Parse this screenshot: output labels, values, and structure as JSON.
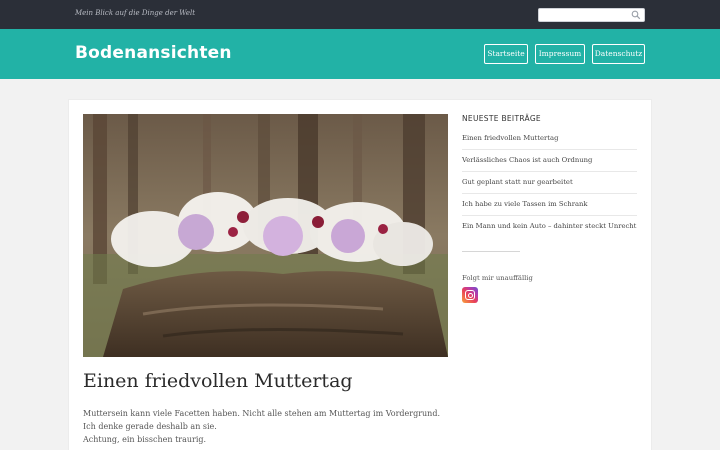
{
  "topbar": {
    "tagline": "Mein Blick auf die Dinge der Welt",
    "search": {
      "value": "",
      "placeholder": ""
    }
  },
  "header": {
    "brand": "Bodenansichten",
    "nav": [
      {
        "label": "Startseite"
      },
      {
        "label": "Impressum"
      },
      {
        "label": "Datenschutz"
      }
    ],
    "accent_color": "#22b2a6"
  },
  "post": {
    "title": "Einen friedvollen Muttertag",
    "paragraph_1": "Muttersein kann viele Facetten haben. Nicht alle stehen am Muttertag im Vordergrund. Ich denke gerade deshalb an sie.",
    "paragraph_2": "Achtung, ein bisschen traurig."
  },
  "sidebar": {
    "heading": "NEUESTE BEITRÄGE",
    "items": [
      {
        "label": "Einen friedvollen Muttertag"
      },
      {
        "label": "Verlässliches Chaos ist auch Ordnung"
      },
      {
        "label": "Gut geplant statt nur gearbeitet"
      },
      {
        "label": "Ich habe zu viele Tassen im Schrank"
      },
      {
        "label": "Ein Mann und kein Auto – dahinter steckt Unrecht"
      }
    ],
    "follow_label": "Folgt mir unauffällig",
    "social_icon": "instagram-icon"
  }
}
